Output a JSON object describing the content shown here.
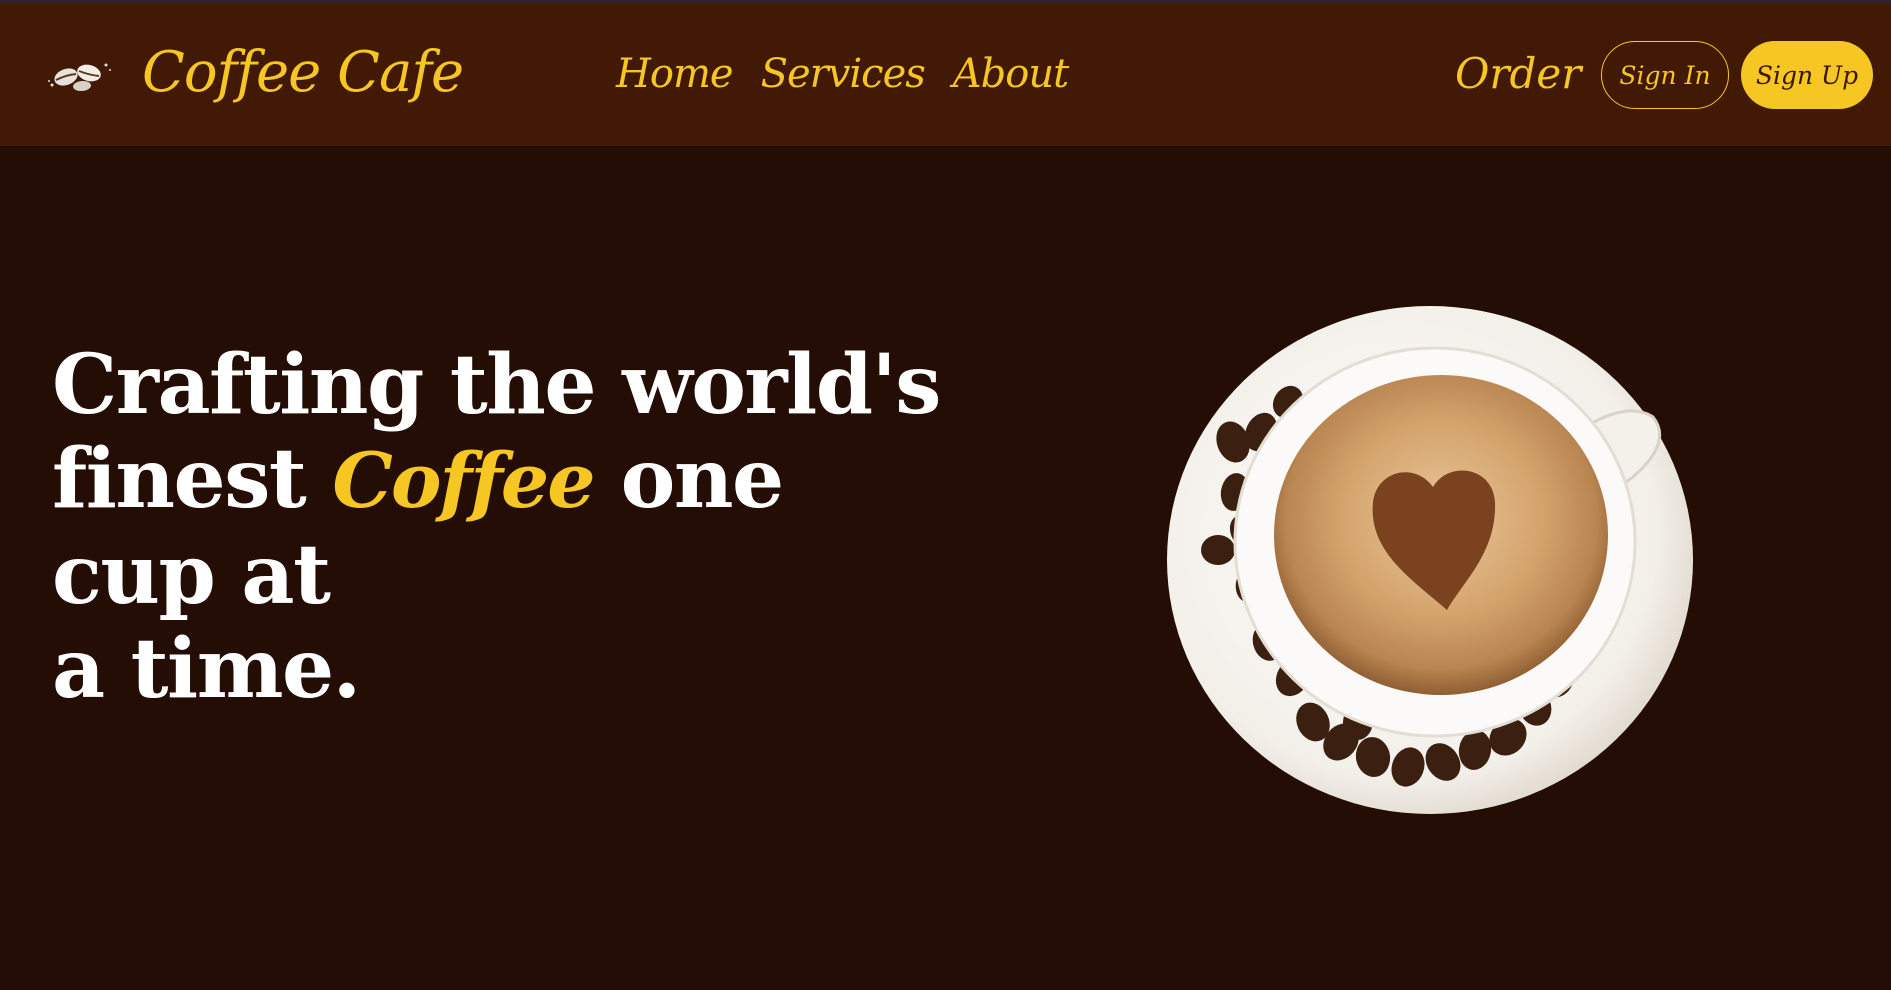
{
  "header": {
    "brand": "Coffee Cafe",
    "logo_icon": "coffee-beans-icon",
    "nav": [
      {
        "label": "Home"
      },
      {
        "label": "Services"
      },
      {
        "label": "About"
      }
    ],
    "order_label": "Order",
    "sign_in_label": "Sign In",
    "sign_up_label": "Sign Up"
  },
  "hero": {
    "line1": "Crafting the world's",
    "line2_before": "finest",
    "accent_word": "Coffee",
    "line2_after": "one cup at",
    "line3": "a time.",
    "image": "coffee-cup-with-heart-latte-art"
  },
  "colors": {
    "header_bg": "#421904",
    "page_bg": "#230d04",
    "accent": "#f6c722",
    "text": "#ffffff"
  }
}
